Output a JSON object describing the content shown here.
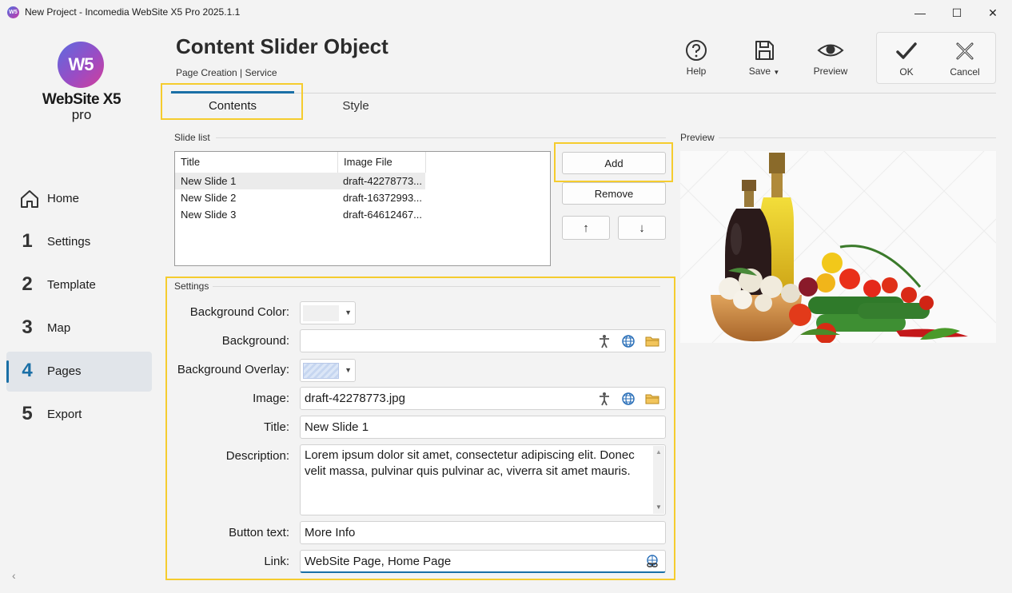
{
  "window": {
    "title": "New Project - Incomedia WebSite X5 Pro 2025.1.1",
    "minimize": "—",
    "maximize": "☐",
    "close": "✕"
  },
  "logo": {
    "badge": "W5",
    "name": "WebSite X5",
    "edition": "pro"
  },
  "sidebar": {
    "items": [
      {
        "label": "Home",
        "num": ""
      },
      {
        "label": "Settings",
        "num": "1"
      },
      {
        "label": "Template",
        "num": "2"
      },
      {
        "label": "Map",
        "num": "3"
      },
      {
        "label": "Pages",
        "num": "4",
        "active": true
      },
      {
        "label": "Export",
        "num": "5"
      }
    ],
    "collapse": "‹"
  },
  "header": {
    "title": "Content Slider Object",
    "breadcrumb": "Page Creation | Service"
  },
  "toolbar": {
    "help": "Help",
    "save": "Save",
    "preview": "Preview",
    "ok": "OK",
    "cancel": "Cancel"
  },
  "tabs": {
    "contents": "Contents",
    "style": "Style"
  },
  "slide_list": {
    "group_label": "Slide list",
    "columns": [
      "Title",
      "Image File"
    ],
    "rows": [
      [
        "New Slide 1",
        "draft-42278773..."
      ],
      [
        "New Slide 2",
        "draft-16372993..."
      ],
      [
        "New Slide 3",
        "draft-64612467..."
      ]
    ],
    "add": "Add",
    "remove": "Remove",
    "up": "↑",
    "down": "↓"
  },
  "preview": {
    "group_label": "Preview"
  },
  "settings": {
    "group_label": "Settings",
    "background_color_label": "Background Color:",
    "background_label": "Background:",
    "background_value": "",
    "background_overlay_label": "Background Overlay:",
    "image_label": "Image:",
    "image_value": "draft-42278773.jpg",
    "title_label": "Title:",
    "title_value": "New Slide 1",
    "description_label": "Description:",
    "description_value": "Lorem ipsum dolor sit amet, consectetur adipiscing elit. Donec velit massa, pulvinar quis pulvinar ac, viverra sit amet mauris.",
    "button_text_label": "Button text:",
    "button_text_value": "More Info",
    "link_label": "Link:",
    "link_value": "WebSite Page, Home Page"
  },
  "colors": {
    "accent": "#1a6fa6",
    "highlight": "#f5cc2e"
  }
}
